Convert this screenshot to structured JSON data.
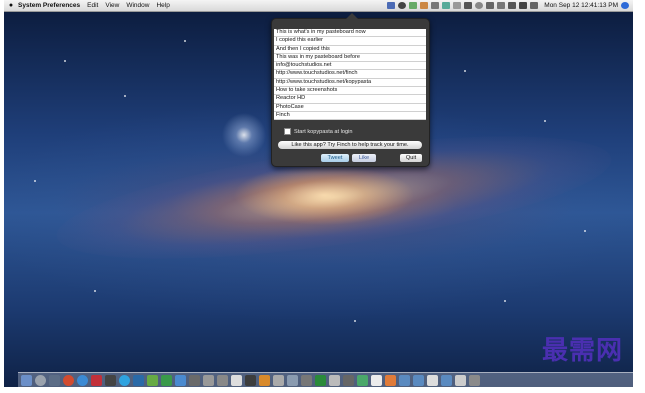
{
  "menubar": {
    "apple": "",
    "app_name": "System Preferences",
    "menus": [
      "Edit",
      "View",
      "Window",
      "Help"
    ],
    "clock": "Mon Sep 12  12:41:13 PM"
  },
  "popup": {
    "clips": [
      "This is what's in my pasteboard now",
      "I copied this earlier",
      "And then I copied this",
      "This was in my pasteboard before",
      "info@touchstudios.net",
      "http://www.touchstudios.net/finch",
      "http://www.touchstudios.net/kopypasta",
      "How to take screenshots",
      "Reactor HD",
      "PhotoCase",
      "Finch"
    ],
    "startup_label": "Start kopypasta at login",
    "finch_label": "Like this app? Try Finch to help track your time.",
    "tweet_label": "Tweet",
    "like_label": "Like",
    "quit_label": "Quit"
  },
  "watermark": "最需网",
  "colors": {
    "popup_bg": "#3a3a3a",
    "watermark": "#4a2fb0"
  }
}
